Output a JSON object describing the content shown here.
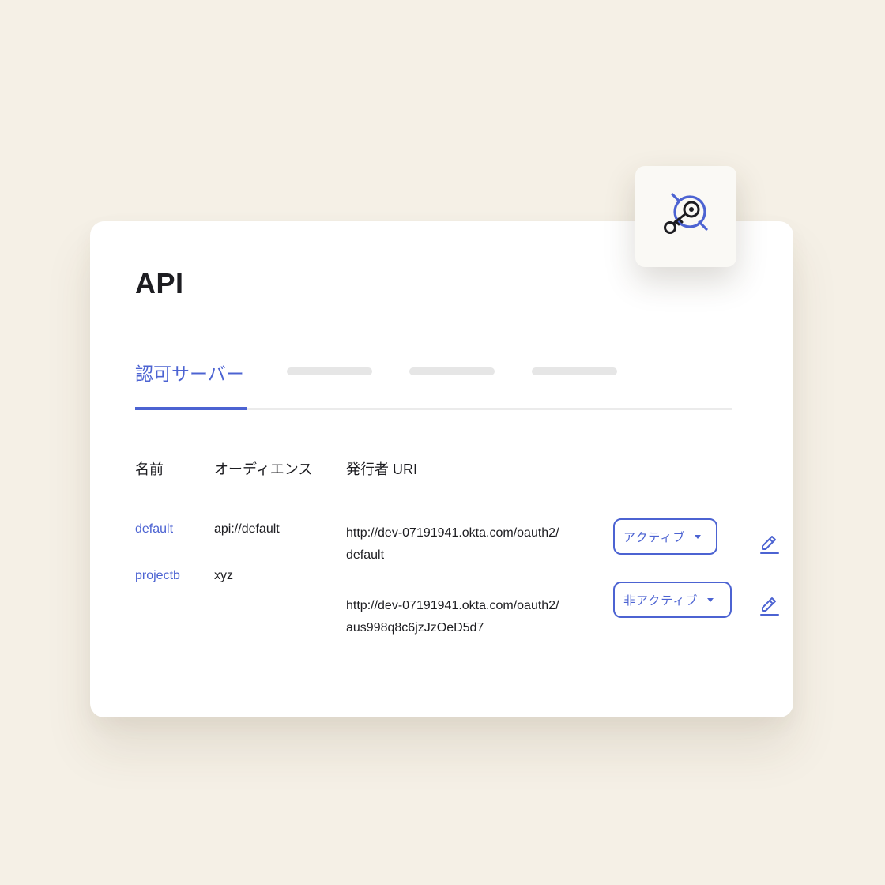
{
  "page": {
    "title": "API"
  },
  "tabs": {
    "active_label": "認可サーバー"
  },
  "table": {
    "headers": {
      "name": "名前",
      "audience": "オーディエンス",
      "issuer": "発行者 URI"
    },
    "rows": [
      {
        "name": "default",
        "audience": "api://default",
        "issuer_line1": "http://dev-07191941.okta.com/oauth2/",
        "issuer_line2": "default",
        "status": "アクティブ"
      },
      {
        "name": "projectb",
        "audience": "xyz",
        "issuer_line1": "http://dev-07191941.okta.com/oauth2/",
        "issuer_line2": "aus998q8c6jzJzOeD5d7",
        "status": "非アクティブ"
      }
    ]
  },
  "icons": {
    "badge": "key-search-icon",
    "edit": "pencil-icon"
  },
  "colors": {
    "accent": "#4c63d2",
    "background": "#f5f0e6",
    "card": "#ffffff",
    "text": "#1d1d21"
  }
}
